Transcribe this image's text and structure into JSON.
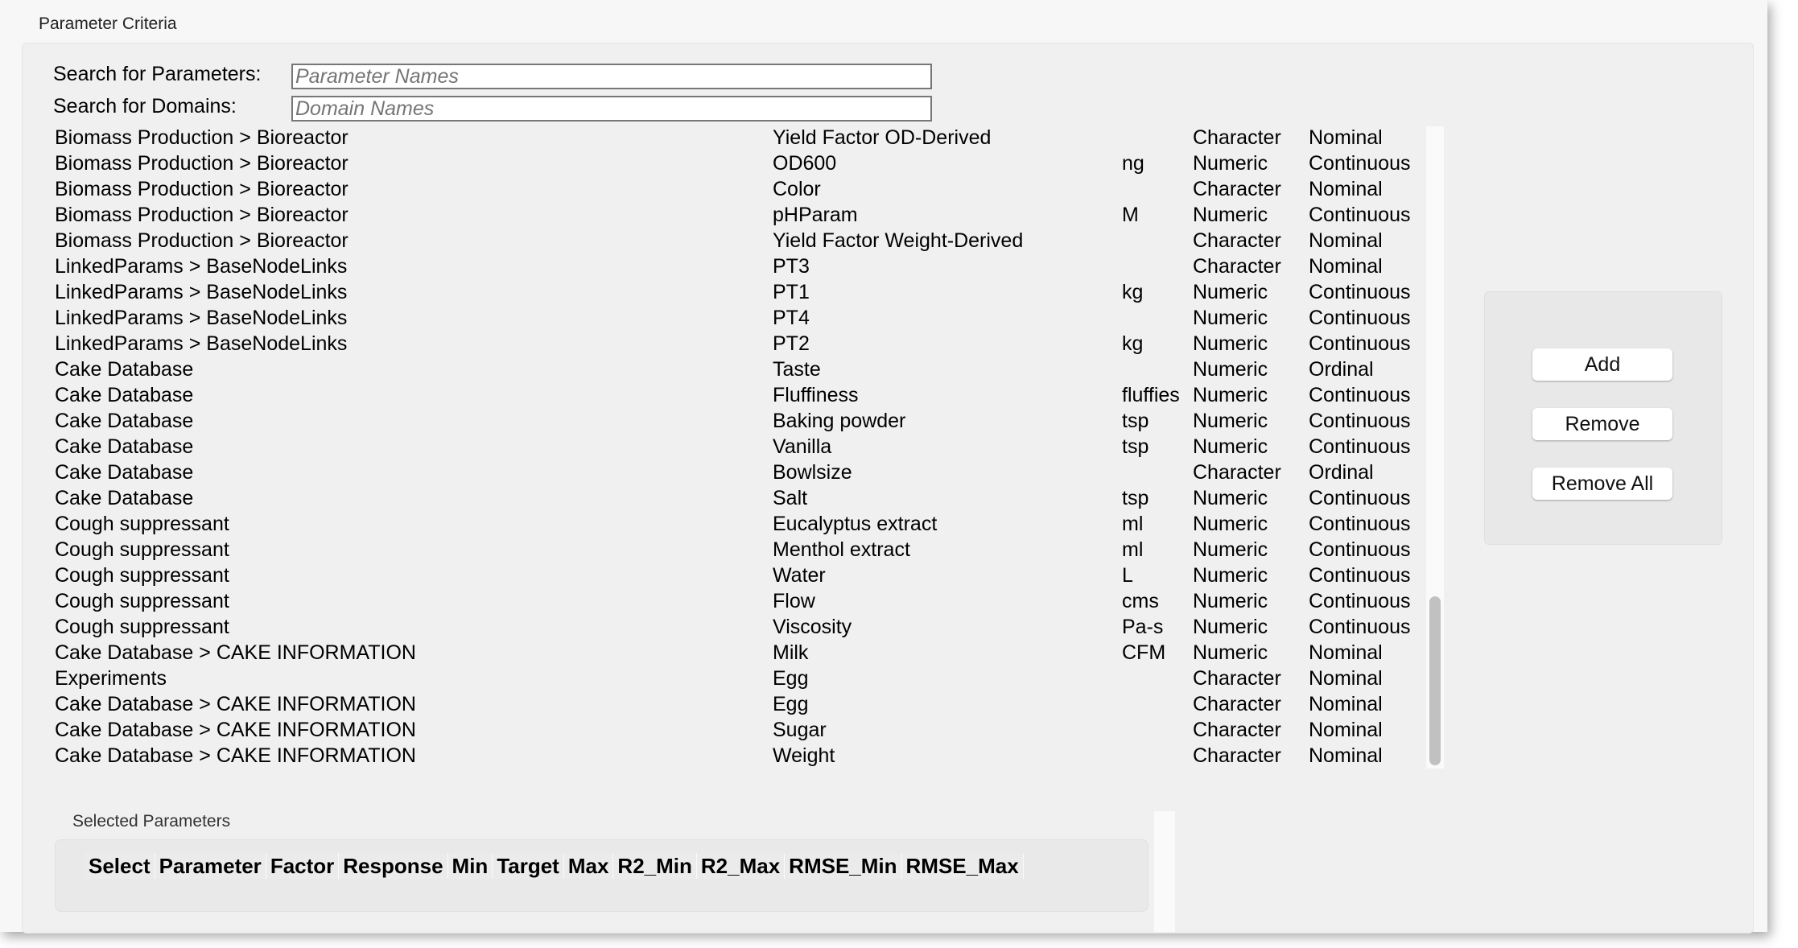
{
  "window": {
    "title": "Parameter Criteria"
  },
  "search": {
    "parameters_label": "Search for Parameters:",
    "parameters_placeholder": "Parameter Names",
    "parameters_value": "",
    "domains_label": "Search for Domains:",
    "domains_placeholder": "Domain Names",
    "domains_value": ""
  },
  "parameters": [
    [
      "Biomass Production > Bioreactor",
      "Yield Factor OD-Derived",
      "",
      "Character",
      "Nominal"
    ],
    [
      "Biomass Production > Bioreactor",
      "OD600",
      "ng",
      "Numeric",
      "Continuous"
    ],
    [
      "Biomass Production > Bioreactor",
      "Color",
      "",
      "Character",
      "Nominal"
    ],
    [
      "Biomass Production > Bioreactor",
      "pHParam",
      "M",
      "Numeric",
      "Continuous"
    ],
    [
      "Biomass Production > Bioreactor",
      "Yield Factor Weight-Derived",
      "",
      "Character",
      "Nominal"
    ],
    [
      "LinkedParams > BaseNodeLinks",
      "PT3",
      "",
      "Character",
      "Nominal"
    ],
    [
      "LinkedParams > BaseNodeLinks",
      "PT1",
      "kg",
      "Numeric",
      "Continuous"
    ],
    [
      "LinkedParams > BaseNodeLinks",
      "PT4",
      "",
      "Numeric",
      "Continuous"
    ],
    [
      "LinkedParams > BaseNodeLinks",
      "PT2",
      "kg",
      "Numeric",
      "Continuous"
    ],
    [
      "Cake Database",
      "Taste",
      "",
      "Numeric",
      "Ordinal"
    ],
    [
      "Cake Database",
      "Fluffiness",
      "fluffies",
      "Numeric",
      "Continuous"
    ],
    [
      "Cake Database",
      "Baking powder",
      "tsp",
      "Numeric",
      "Continuous"
    ],
    [
      "Cake Database",
      "Vanilla",
      "tsp",
      "Numeric",
      "Continuous"
    ],
    [
      "Cake Database",
      "Bowlsize",
      "",
      "Character",
      "Ordinal"
    ],
    [
      "Cake Database",
      "Salt",
      "tsp",
      "Numeric",
      "Continuous"
    ],
    [
      "Cough suppressant",
      "Eucalyptus extract",
      "ml",
      "Numeric",
      "Continuous"
    ],
    [
      "Cough suppressant",
      "Menthol extract",
      "ml",
      "Numeric",
      "Continuous"
    ],
    [
      "Cough suppressant",
      "Water",
      "L",
      "Numeric",
      "Continuous"
    ],
    [
      "Cough suppressant",
      "Flow",
      "cms",
      "Numeric",
      "Continuous"
    ],
    [
      "Cough suppressant",
      "Viscosity",
      "Pa-s",
      "Numeric",
      "Continuous"
    ],
    [
      "Cake Database > CAKE INFORMATION",
      "Milk",
      "CFM",
      "Numeric",
      "Nominal"
    ],
    [
      "Experiments",
      "Egg",
      "",
      "Character",
      "Nominal"
    ],
    [
      "Cake Database > CAKE INFORMATION",
      "Egg",
      "",
      "Character",
      "Nominal"
    ],
    [
      "Cake Database > CAKE INFORMATION",
      "Sugar",
      "",
      "Character",
      "Nominal"
    ],
    [
      "Cake Database > CAKE INFORMATION",
      "Weight",
      "",
      "Character",
      "Nominal"
    ]
  ],
  "actions": {
    "add": "Add",
    "remove": "Remove",
    "remove_all": "Remove All"
  },
  "selected": {
    "label": "Selected Parameters",
    "columns": [
      "Select",
      "Parameter",
      "Factor",
      "Response",
      "Min",
      "Target",
      "Max",
      "R2_Min",
      "R2_Max",
      "RMSE_Min",
      "RMSE_Max"
    ]
  }
}
